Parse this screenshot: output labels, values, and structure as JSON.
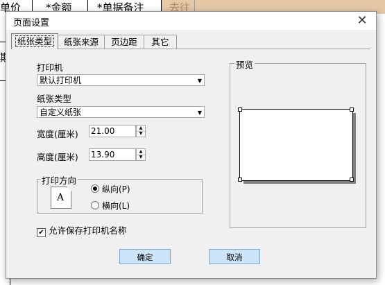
{
  "background": {
    "col1": "单价",
    "col2": "*金额",
    "col3": "*单据备注",
    "col4": "去往",
    "rowlabel": "期"
  },
  "dialog": {
    "title": "页面设置",
    "tabs": [
      "纸张类型",
      "纸张来源",
      "页边距",
      "其它"
    ],
    "printer_label": "打印机",
    "printer_value": "默认打印机",
    "paper_type_label": "纸张类型",
    "paper_type_value": "自定义纸张",
    "width_label": "宽度(厘米)",
    "width_value": "21.00",
    "height_label": "高度(厘米)",
    "height_value": "13.90",
    "orientation_title": "打印方向",
    "portrait_label": "纵向(P)",
    "landscape_label": "横向(L)",
    "orientation_selected": "portrait",
    "allow_save_label": "允许保存打印机名称",
    "allow_save_checked": true,
    "preview_title": "预览",
    "ok_label": "确定",
    "cancel_label": "取消",
    "doc_icon_letter": "A"
  },
  "colors": {
    "accent_button": "#cce4f7",
    "header_cell": "#e5c9a7"
  }
}
